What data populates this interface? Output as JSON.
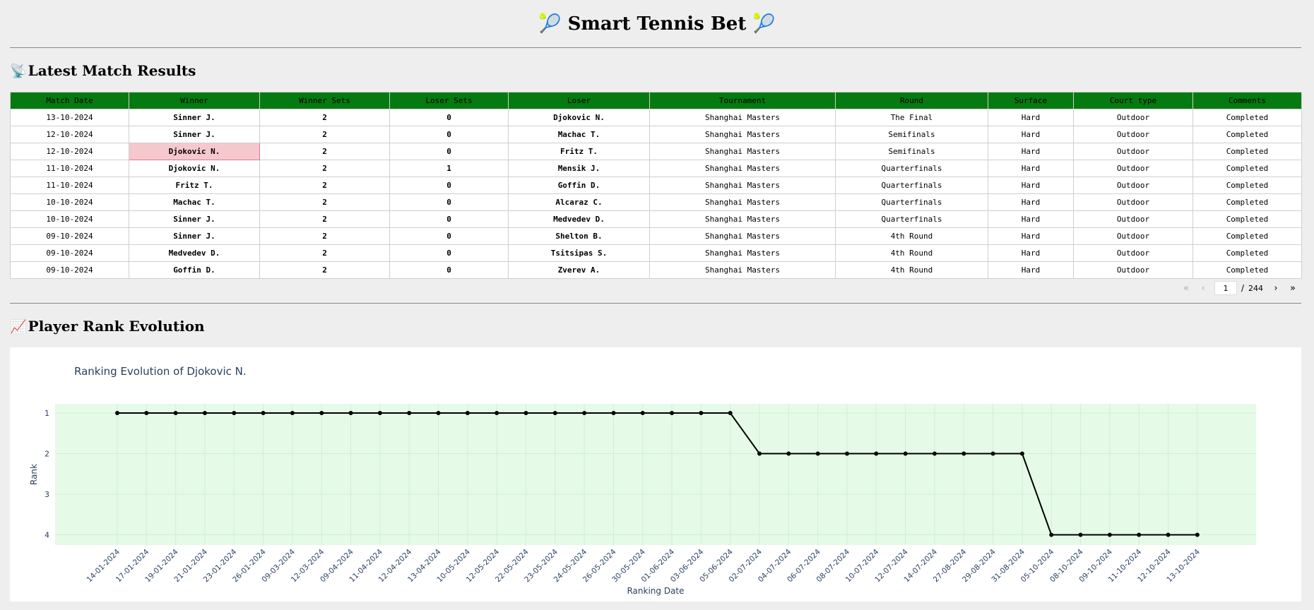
{
  "app": {
    "title_prefix_icon": "🎾",
    "title": "Smart Tennis Bet",
    "title_suffix_icon": "🎾"
  },
  "results_section": {
    "icon": "📡",
    "title": "Latest Match Results"
  },
  "table": {
    "columns": [
      "Match Date",
      "Winner",
      "Winner Sets",
      "Loser Sets",
      "Loser",
      "Tournament",
      "Round",
      "Surface",
      "Court type",
      "Comments"
    ],
    "rows": [
      [
        "13-10-2024",
        "Sinner J.",
        "2",
        "0",
        "Djokovic N.",
        "Shanghai Masters",
        "The Final",
        "Hard",
        "Outdoor",
        "Completed"
      ],
      [
        "12-10-2024",
        "Sinner J.",
        "2",
        "0",
        "Machac T.",
        "Shanghai Masters",
        "Semifinals",
        "Hard",
        "Outdoor",
        "Completed"
      ],
      [
        "12-10-2024",
        "Djokovic N.",
        "2",
        "0",
        "Fritz T.",
        "Shanghai Masters",
        "Semifinals",
        "Hard",
        "Outdoor",
        "Completed"
      ],
      [
        "11-10-2024",
        "Djokovic N.",
        "2",
        "1",
        "Mensik J.",
        "Shanghai Masters",
        "Quarterfinals",
        "Hard",
        "Outdoor",
        "Completed"
      ],
      [
        "11-10-2024",
        "Fritz T.",
        "2",
        "0",
        "Goffin D.",
        "Shanghai Masters",
        "Quarterfinals",
        "Hard",
        "Outdoor",
        "Completed"
      ],
      [
        "10-10-2024",
        "Machac T.",
        "2",
        "0",
        "Alcaraz C.",
        "Shanghai Masters",
        "Quarterfinals",
        "Hard",
        "Outdoor",
        "Completed"
      ],
      [
        "10-10-2024",
        "Sinner J.",
        "2",
        "0",
        "Medvedev D.",
        "Shanghai Masters",
        "Quarterfinals",
        "Hard",
        "Outdoor",
        "Completed"
      ],
      [
        "09-10-2024",
        "Sinner J.",
        "2",
        "0",
        "Shelton B.",
        "Shanghai Masters",
        "4th Round",
        "Hard",
        "Outdoor",
        "Completed"
      ],
      [
        "09-10-2024",
        "Medvedev D.",
        "2",
        "0",
        "Tsitsipas S.",
        "Shanghai Masters",
        "4th Round",
        "Hard",
        "Outdoor",
        "Completed"
      ],
      [
        "09-10-2024",
        "Goffin D.",
        "2",
        "0",
        "Zverev A.",
        "Shanghai Masters",
        "4th Round",
        "Hard",
        "Outdoor",
        "Completed"
      ]
    ],
    "selected_row": 2,
    "selected_col": 1
  },
  "pagination": {
    "first_icon": "«",
    "prev_icon": "‹",
    "current_page": "1",
    "separator": "/",
    "total_pages": "244",
    "next_icon": "›",
    "last_icon": "»"
  },
  "rank_section": {
    "icon": "📈",
    "title": "Player Rank Evolution"
  },
  "colors": {
    "header_bg": "#047a10",
    "plot_bg": "#e5fbe8",
    "line": "#000000",
    "highlight": "#f5c8cd",
    "axis_text": "#2a3f5f"
  },
  "chart_data": {
    "type": "line",
    "title": "Ranking Evolution of Djokovic N.",
    "xlabel": "Ranking Date",
    "ylabel": "Rank",
    "y_reversed": true,
    "ylim": [
      1,
      4
    ],
    "yticks": [
      "1",
      "2",
      "3",
      "4"
    ],
    "grid": true,
    "x": [
      "14-01-2024",
      "17-01-2024",
      "19-01-2024",
      "21-01-2024",
      "23-01-2024",
      "26-01-2024",
      "09-03-2024",
      "12-03-2024",
      "09-04-2024",
      "11-04-2024",
      "12-04-2024",
      "13-04-2024",
      "10-05-2024",
      "12-05-2024",
      "22-05-2024",
      "23-05-2024",
      "24-05-2024",
      "26-05-2024",
      "30-05-2024",
      "01-06-2024",
      "03-06-2024",
      "05-06-2024",
      "02-07-2024",
      "04-07-2024",
      "06-07-2024",
      "08-07-2024",
      "10-07-2024",
      "12-07-2024",
      "14-07-2024",
      "27-08-2024",
      "29-08-2024",
      "31-08-2024",
      "05-10-2024",
      "08-10-2024",
      "09-10-2024",
      "11-10-2024",
      "12-10-2024",
      "13-10-2024"
    ],
    "series": [
      {
        "values": [
          1,
          1,
          1,
          1,
          1,
          1,
          1,
          1,
          1,
          1,
          1,
          1,
          1,
          1,
          1,
          1,
          1,
          1,
          1,
          1,
          1,
          1,
          2,
          2,
          2,
          2,
          2,
          2,
          2,
          2,
          2,
          2,
          4,
          4,
          4,
          4,
          4,
          4
        ]
      }
    ]
  }
}
